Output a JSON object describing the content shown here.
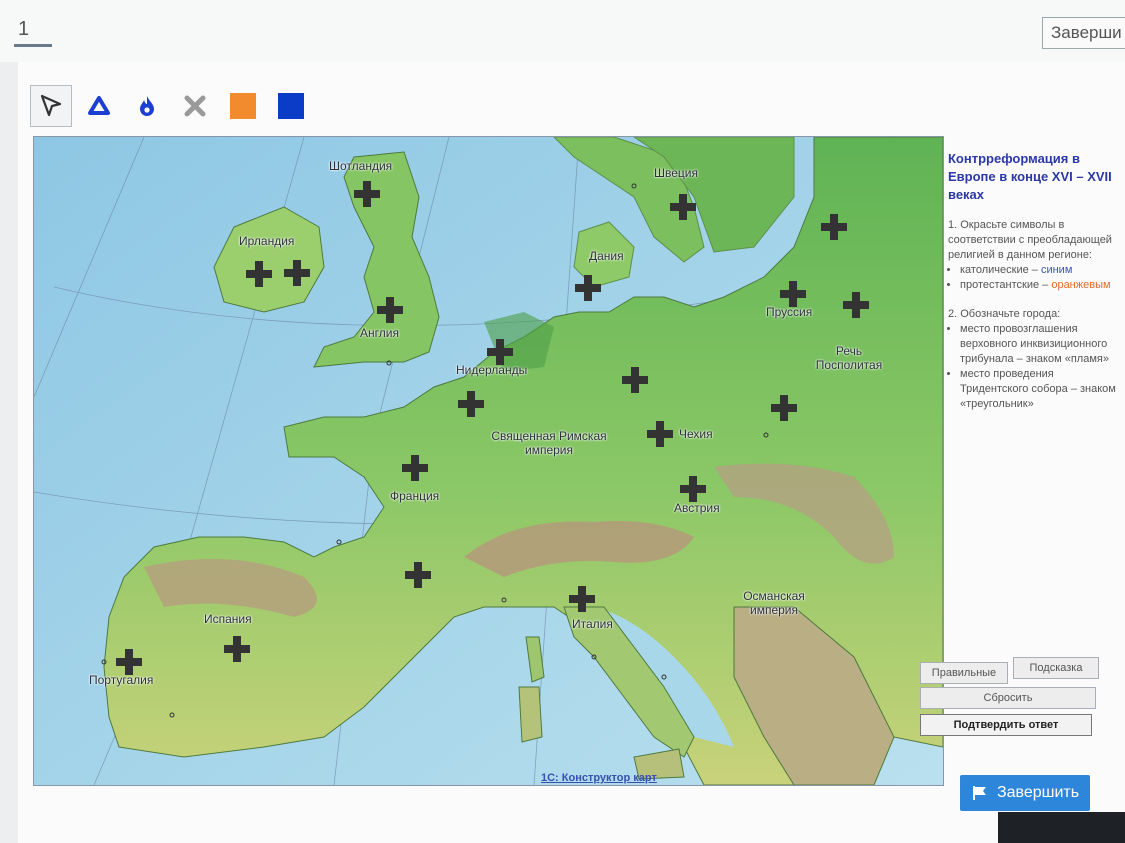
{
  "question": {
    "number": "1"
  },
  "top_finish_label": "Заверши",
  "tools": [
    {
      "name": "pointer-tool",
      "icon": "cursor-arrow-icon",
      "active": true
    },
    {
      "name": "triangle-tool",
      "icon": "triangle-icon"
    },
    {
      "name": "flame-tool",
      "icon": "flame-icon"
    },
    {
      "name": "eraser-tool",
      "icon": "cross-icon"
    },
    {
      "name": "orange-color",
      "icon": "orange-swatch",
      "color": "#f28a2e"
    },
    {
      "name": "blue-color",
      "icon": "blue-swatch",
      "color": "#0a3cc8"
    }
  ],
  "map": {
    "labels": {
      "scotland": "Шотландия",
      "ireland": "Ирландия",
      "england": "Англия",
      "sweden": "Швеция",
      "denmark": "Дания",
      "prussia": "Пруссия",
      "poland": "Речь Посполитая",
      "netherlands": "Нидерланды",
      "hre": "Священная Римская империя",
      "czech": "Чехия",
      "france": "Франция",
      "austria": "Австрия",
      "spain": "Испания",
      "portugal": "Португалия",
      "italy": "Италия",
      "ottoman": "Османская империя"
    }
  },
  "sidebar": {
    "title": "Контрреформация в Европе в конце XVI – XVII веках",
    "task1": "1. Окрасьте символы в соответствии с преобладающей религией в данном регионе:",
    "catholic_prefix": "католические –",
    "catholic_color": "синим",
    "protestant_prefix": "протестантские –",
    "protestant_color": "оранжевым",
    "task2": "2. Обозначьте города:",
    "bullet3": "место провозглашения верховного инквизиционного трибунала – знаком «пламя»",
    "bullet4": "место проведения Тридентского собора – знаком «треугольник»"
  },
  "buttons": {
    "correct": "Правильные",
    "hint": "Подсказка",
    "reset": "Сбросить",
    "confirm": "Подтвердить ответ"
  },
  "footer_link": "1С: Конструктор карт",
  "finish": {
    "label": "Завершить",
    "icon": "flag-icon"
  }
}
